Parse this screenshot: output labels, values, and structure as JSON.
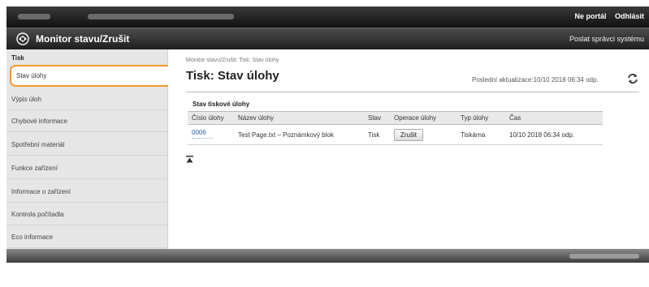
{
  "topbar": {
    "portal_label": "Ne portál",
    "logout_label": "Odhlásit"
  },
  "titlebar": {
    "title": "Monitor stavu/Zrušit",
    "admin_link": "Poslat správci systému"
  },
  "sidebar": {
    "section": "Tisk",
    "items": [
      {
        "label": "Stav úlohy"
      },
      {
        "label": "Výpis úloh"
      },
      {
        "label": "Chybové informace"
      },
      {
        "label": "Spotřební materiál"
      },
      {
        "label": "Funkce zařízení"
      },
      {
        "label": "Informace o zařízení"
      },
      {
        "label": "Kontrola počítadla"
      },
      {
        "label": "Eco informace"
      }
    ]
  },
  "main": {
    "breadcrumb": "Monitor stavu/Zrušit: Tisk: Stav úlohy",
    "heading": "Tisk: Stav úlohy",
    "last_updated": "Poslední aktualizace:10/10 2018 06:34 odp.",
    "group_label": "Stav tiskové úlohy",
    "table": {
      "headers": [
        "Číslo úlohy",
        "Název úlohy",
        "Stav",
        "Operace úlohy",
        "Typ úlohy",
        "Čas"
      ],
      "rows": [
        {
          "job_number": "0006",
          "job_name": "Test Page.txt – Poznámkový blok",
          "status": "Tisk",
          "action": "Zrušit",
          "job_type": "Tiskárna",
          "time": "10/10 2018 06:34 odp."
        }
      ]
    }
  },
  "colors": {
    "accent_outline": "#f29a2e",
    "header_dark": "#1e1e1e",
    "link": "#2a5fb0"
  }
}
